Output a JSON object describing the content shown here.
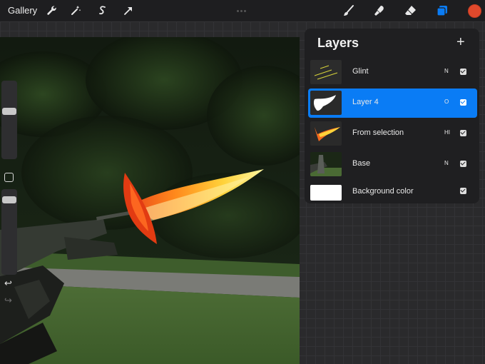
{
  "toolbar": {
    "gallery_label": "Gallery",
    "left_tools": [
      "wrench-icon",
      "magic-wand-icon",
      "selection-icon",
      "transform-arrow-icon"
    ],
    "right_tools": [
      "brush-icon",
      "smudge-icon",
      "eraser-icon",
      "layers-icon"
    ],
    "current_color": "#e0492c",
    "accent_color": "#0a7cf5"
  },
  "layers_panel": {
    "title": "Layers",
    "add_label": "+",
    "layers": [
      {
        "name": "Glint",
        "blend": "N",
        "visible": true,
        "active": false
      },
      {
        "name": "Layer 4",
        "blend": "O",
        "visible": true,
        "active": true
      },
      {
        "name": "From selection",
        "blend": "HI",
        "visible": true,
        "active": false
      },
      {
        "name": "Base",
        "blend": "N",
        "visible": true,
        "active": false
      },
      {
        "name": "Background color",
        "blend": "",
        "visible": true,
        "active": false
      }
    ]
  },
  "sidebar": {
    "undo_label": "↩",
    "redo_label": "↪"
  }
}
